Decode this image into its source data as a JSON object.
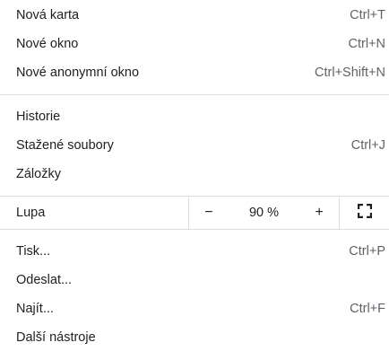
{
  "group1": [
    {
      "label": "Nová karta",
      "shortcut": "Ctrl+T"
    },
    {
      "label": "Nové okno",
      "shortcut": "Ctrl+N"
    },
    {
      "label": "Nové anonymní okno",
      "shortcut": "Ctrl+Shift+N"
    }
  ],
  "group2": [
    {
      "label": "Historie",
      "shortcut": ""
    },
    {
      "label": "Stažené soubory",
      "shortcut": "Ctrl+J"
    },
    {
      "label": "Záložky",
      "shortcut": ""
    }
  ],
  "zoom": {
    "label": "Lupa",
    "minus": "−",
    "value": "90 %",
    "plus": "+",
    "fullscreen_icon": "fullscreen-icon"
  },
  "group3": [
    {
      "label": "Tisk...",
      "shortcut": "Ctrl+P"
    },
    {
      "label": "Odeslat...",
      "shortcut": ""
    },
    {
      "label": "Najít...",
      "shortcut": "Ctrl+F"
    },
    {
      "label": "Další nástroje",
      "shortcut": ""
    }
  ]
}
